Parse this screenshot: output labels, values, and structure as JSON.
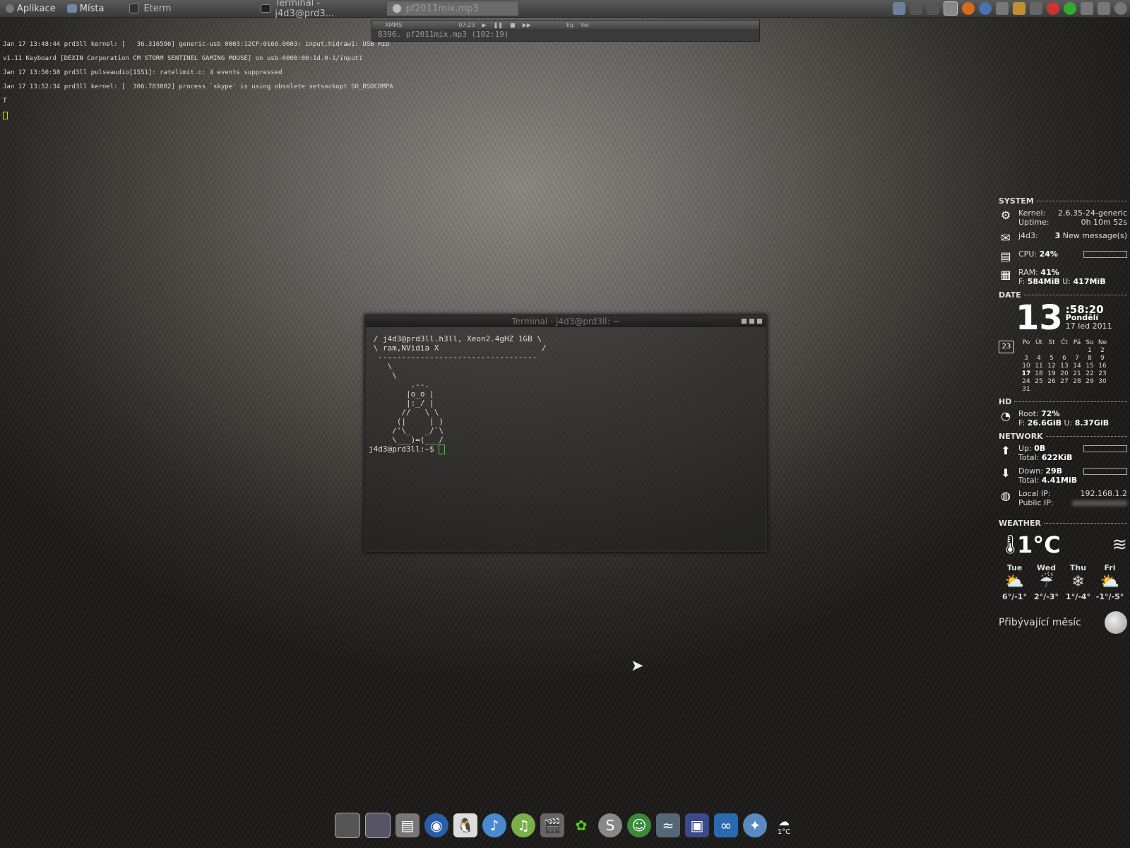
{
  "panel": {
    "menu_apps": "Aplikace",
    "menu_places": "Místa",
    "tasks": [
      {
        "label": "Eterm"
      },
      {
        "label": "Terminal - j4d3@prd3..."
      },
      {
        "label": "pf2011mix.mp3"
      }
    ]
  },
  "console_log": [
    "Jan 17 13:48:44 prd3ll kernel: [   36.316596] generic-usb 0003:12CF:0166.0003: input,hidraw1: USB HID",
    "v1.11 Keyboard [DEXIN Corporation CM STORM SENTINEL GAMING MOUSE] on usb-0000:00:1d.0-1/input1",
    "Jan 17 13:50:58 prd3ll pulseaudio[1551]: ratelimit.c: 4 events suppressed",
    "Jan 17 13:52:34 prd3ll kernel: [  306.783082] process `skype' is using obsolete setsockopt SO_BSDCOMPA",
    "T"
  ],
  "xmms": {
    "app_label": "XMMS",
    "time": "07:23",
    "eq": "Eq",
    "vol": "Vol",
    "track": "8396. pf2011mix.mp3  (102:19)"
  },
  "terminal": {
    "title": "Terminal - j4d3@prd3ll: ~",
    "cowsay": " / j4d3@prd3ll.h3ll, Xeon2.4gHZ 1GB \\\n \\ ram,NVidia X                      /\n  ----------------------------------\n    \\\n     \\\n         .--.\n        |o_o |\n        |:_/ |\n       //   \\ \\\n      (|     | )\n     /'\\_   _/`\\\n     \\___)=(___/",
    "prompt": "j4d3@prd3ll:~$ "
  },
  "conky": {
    "system": {
      "heading": "SYSTEM",
      "kernel_label": "Kernel:",
      "kernel": "2.6.35-24-generic",
      "uptime_label": "Uptime:",
      "uptime": "0h 10m 52s",
      "mail_user": "j4d3:",
      "mail_count": "3",
      "mail_text": "New message(s)",
      "cpu_label": "CPU:",
      "cpu": "24%",
      "ram_label": "RAM:",
      "ram": "41%",
      "ram_free_label": "F:",
      "ram_free": "584MiB",
      "ram_used_label": "U:",
      "ram_used": "417MiB"
    },
    "date": {
      "heading": "DATE",
      "day_big": "13",
      "time_rest": ":58:20",
      "weekday": "Pondělí",
      "date_text": "17 led 2011",
      "cal_icon_num": "23",
      "cal_headers": [
        "Po",
        "Út",
        "St",
        "Čt",
        "Pá",
        "So",
        "Ne"
      ],
      "cal_cells": [
        "",
        "",
        "",
        "",
        "",
        "1",
        "2",
        "3",
        "4",
        "5",
        "6",
        "7",
        "8",
        "9",
        "10",
        "11",
        "12",
        "13",
        "14",
        "15",
        "16",
        "17",
        "18",
        "19",
        "20",
        "21",
        "22",
        "23",
        "24",
        "25",
        "26",
        "27",
        "28",
        "29",
        "30",
        "31",
        "",
        "",
        "",
        "",
        "",
        ""
      ],
      "today": "17"
    },
    "hd": {
      "heading": "HD",
      "root_label": "Root:",
      "root": "72%",
      "free_label": "F:",
      "free": "26.6GiB",
      "used_label": "U:",
      "used": "8.37GiB"
    },
    "network": {
      "heading": "NETWORK",
      "up_label": "Up:",
      "up": "0B",
      "up_total_label": "Total:",
      "up_total": "622KiB",
      "down_label": "Down:",
      "down": "29B",
      "down_total_label": "Total:",
      "down_total": "4.41MiB",
      "local_ip_label": "Local IP:",
      "local_ip": "192.168.1.2",
      "public_ip_label": "Public IP:"
    },
    "weather": {
      "heading": "WEATHER",
      "temp": "1°C",
      "days": [
        {
          "name": "Tue",
          "temps": "6°/-1°"
        },
        {
          "name": "Wed",
          "temps": "2°/-3°"
        },
        {
          "name": "Thu",
          "temps": "1°/-4°"
        },
        {
          "name": "Fri",
          "temps": "-1°/-5°"
        }
      ],
      "moon": "Přibývající měsíc"
    }
  },
  "dock": {
    "weather_badge": "1°C"
  },
  "colors": {
    "accent_cursor": "#44cc44",
    "log_cursor": "#dddd00"
  }
}
